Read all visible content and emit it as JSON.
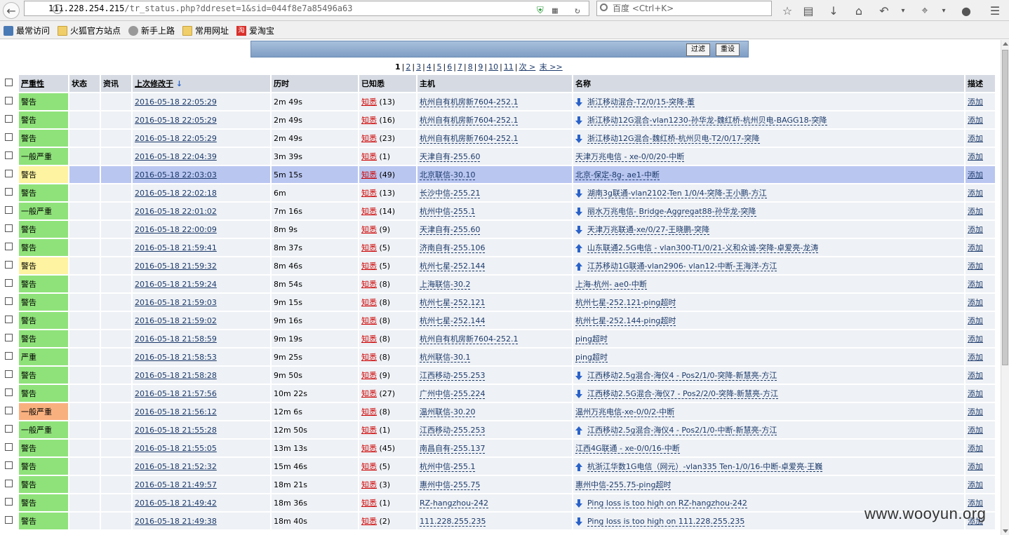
{
  "browser": {
    "url_host": "111.228.254.215",
    "url_path": "/tr_status.php?ddreset=1&sid=044f8e7a85496a63",
    "search_placeholder": "百度 <Ctrl+K>",
    "bookmarks": [
      {
        "label": "最常访问",
        "icon": "blue"
      },
      {
        "label": "火狐官方站点",
        "icon": "folder"
      },
      {
        "label": "新手上路",
        "icon": "globe"
      },
      {
        "label": "常用网址",
        "icon": "folder"
      },
      {
        "label": "爱淘宝",
        "icon": "taobao"
      }
    ],
    "taobao_icon_glyph": "淘"
  },
  "filter": {
    "filter_label": "过滤",
    "reset_label": "重设"
  },
  "pager": {
    "pages": [
      "1",
      "2",
      "3",
      "4",
      "5",
      "6",
      "7",
      "8",
      "9",
      "10",
      "11"
    ],
    "current": "1",
    "next_label": "次 >",
    "last_label": "末 >>"
  },
  "table": {
    "headers": {
      "severity": "严重性",
      "status": "状态",
      "info": "资讯",
      "last_change": "上次修改于",
      "age": "历时",
      "ack": "已知悉",
      "host": "主机",
      "name": "名称",
      "desc": "描述"
    },
    "ack_label": "知悉",
    "desc_label": "添加",
    "rows": [
      {
        "severity": "警告",
        "color": "green",
        "time": "2016-05-18 22:05:29",
        "age": "2m 49s",
        "ack": "(13)",
        "host": "杭州自有机房新7604-252.1",
        "arrow": "down",
        "name": "浙江移动混合-T2/0/15-突降-董"
      },
      {
        "severity": "警告",
        "color": "green",
        "time": "2016-05-18 22:05:29",
        "age": "2m 49s",
        "ack": "(16)",
        "host": "杭州自有机房新7604-252.1",
        "arrow": "down",
        "name": "浙江移动12G混合-vlan1230-孙华龙-魏红桥-杭州贝电-BAGG18-突降"
      },
      {
        "severity": "警告",
        "color": "green",
        "time": "2016-05-18 22:05:29",
        "age": "2m 49s",
        "ack": "(23)",
        "host": "杭州自有机房新7604-252.1",
        "arrow": "down",
        "name": "浙江移动12G混合-魏红桥-杭州贝电-T2/0/17-突降"
      },
      {
        "severity": "一般严重",
        "color": "green",
        "time": "2016-05-18 22:04:39",
        "age": "3m 39s",
        "ack": "(1)",
        "host": "天津自有-255.60",
        "arrow": "",
        "name": "天津万兆电信 - xe-0/0/20-中断"
      },
      {
        "severity": "警告",
        "color": "yellow",
        "time": "2016-05-18 22:03:03",
        "age": "5m 15s",
        "ack": "(49)",
        "host": "北京联信-30.10",
        "arrow": "",
        "name": "北京-保定-8g- ae1-中断",
        "hl": true
      },
      {
        "severity": "警告",
        "color": "green",
        "time": "2016-05-18 22:02:18",
        "age": "6m",
        "ack": "(13)",
        "host": "长沙中信-255.21",
        "arrow": "down",
        "name": "湖南3g联通-vlan2102-Ten 1/0/4-突降-王小鹏-方江"
      },
      {
        "severity": "一般严重",
        "color": "green",
        "time": "2016-05-18 22:01:02",
        "age": "7m 16s",
        "ack": "(14)",
        "host": "杭州中信-255.1",
        "arrow": "down",
        "name": "丽水万兆电信- Bridge-Aggregat88-孙华龙-突降"
      },
      {
        "severity": "警告",
        "color": "green",
        "time": "2016-05-18 22:00:09",
        "age": "8m 9s",
        "ack": "(9)",
        "host": "天津自有-255.60",
        "arrow": "down",
        "name": "天津万兆联通-xe/0/27-王晓鹏-突降"
      },
      {
        "severity": "警告",
        "color": "green",
        "time": "2016-05-18 21:59:41",
        "age": "8m 37s",
        "ack": "(5)",
        "host": "济南自有-255.106",
        "arrow": "up",
        "name": "山东联通2.5G电信 - vlan300-T1/0/21-义和众诚-突降-卓爱亮-龙涛"
      },
      {
        "severity": "警告",
        "color": "yellow",
        "time": "2016-05-18 21:59:32",
        "age": "8m 46s",
        "ack": "(5)",
        "host": "杭州七星-252.144",
        "arrow": "up",
        "name": "江苏移动1G联通-vlan2906- vlan12-中断-王海洋-方江"
      },
      {
        "severity": "警告",
        "color": "green",
        "time": "2016-05-18 21:59:24",
        "age": "8m 54s",
        "ack": "(8)",
        "host": "上海联信-30.2",
        "arrow": "",
        "name": "上海-杭州- ae0-中断"
      },
      {
        "severity": "警告",
        "color": "green",
        "time": "2016-05-18 21:59:03",
        "age": "9m 15s",
        "ack": "(8)",
        "host": "杭州七星-252.121",
        "arrow": "",
        "name": "杭州七星-252.121-ping超时"
      },
      {
        "severity": "警告",
        "color": "green",
        "time": "2016-05-18 21:59:02",
        "age": "9m 16s",
        "ack": "(8)",
        "host": "杭州七星-252.144",
        "arrow": "",
        "name": "杭州七星-252.144-ping超时"
      },
      {
        "severity": "警告",
        "color": "green",
        "time": "2016-05-18 21:58:59",
        "age": "9m 19s",
        "ack": "(8)",
        "host": "杭州自有机房新7604-252.1",
        "arrow": "",
        "name": "ping超时"
      },
      {
        "severity": "严重",
        "color": "green",
        "time": "2016-05-18 21:58:53",
        "age": "9m 25s",
        "ack": "(8)",
        "host": "杭州联信-30.1",
        "arrow": "",
        "name": "ping超时"
      },
      {
        "severity": "警告",
        "color": "green",
        "time": "2016-05-18 21:58:28",
        "age": "9m 50s",
        "ack": "(9)",
        "host": "江西移动-255.253",
        "arrow": "down",
        "name": "江西移动2.5g混合-海仪4 - Pos2/1/0-突降-新慧亮-方江"
      },
      {
        "severity": "警告",
        "color": "green",
        "time": "2016-05-18 21:57:56",
        "age": "10m 22s",
        "ack": "(27)",
        "host": "广州中信-255.224",
        "arrow": "down",
        "name": "江西移动2.5G混合-海仪7 - Pos2/2/0-突降-新慧亮-方江"
      },
      {
        "severity": "一般严重",
        "color": "orange",
        "time": "2016-05-18 21:56:12",
        "age": "12m 6s",
        "ack": "(8)",
        "host": "温州联信-30.20",
        "arrow": "",
        "name": "温州万兆电信-xe-0/0/2-中断"
      },
      {
        "severity": "一般严重",
        "color": "green",
        "time": "2016-05-18 21:55:28",
        "age": "12m 50s",
        "ack": "(1)",
        "host": "江西移动-255.253",
        "arrow": "up",
        "name": "江西移动2.5g混合-海仪4 - Pos2/1/0-中断-新慧亮-方江"
      },
      {
        "severity": "警告",
        "color": "green",
        "time": "2016-05-18 21:55:05",
        "age": "13m 13s",
        "ack": "(45)",
        "host": "南昌自有-255.137",
        "arrow": "",
        "name": "江西4G联通 - xe-0/0/16-中断"
      },
      {
        "severity": "警告",
        "color": "green",
        "time": "2016-05-18 21:52:32",
        "age": "15m 46s",
        "ack": "(5)",
        "host": "杭州中信-255.1",
        "arrow": "up",
        "name": "杭浙江华数1G电信（网元）-vlan335 Ten-1/0/16-中断-卓爱亮-王巍"
      },
      {
        "severity": "警告",
        "color": "green",
        "time": "2016-05-18 21:49:57",
        "age": "18m 21s",
        "ack": "(3)",
        "host": "惠州中信-255.75",
        "arrow": "",
        "name": "惠州中信-255.75-ping超时"
      },
      {
        "severity": "警告",
        "color": "green",
        "time": "2016-05-18 21:49:42",
        "age": "18m 36s",
        "ack": "(1)",
        "host": "RZ-hangzhou-242",
        "arrow": "down",
        "name": "Ping loss is too high on RZ-hangzhou-242"
      },
      {
        "severity": "警告",
        "color": "green",
        "time": "2016-05-18 21:49:38",
        "age": "18m 40s",
        "ack": "(2)",
        "host": "111.228.255.235",
        "arrow": "down",
        "name": "Ping loss is too high on 111.228.255.235"
      }
    ]
  },
  "watermark": "www.wooyun.org"
}
